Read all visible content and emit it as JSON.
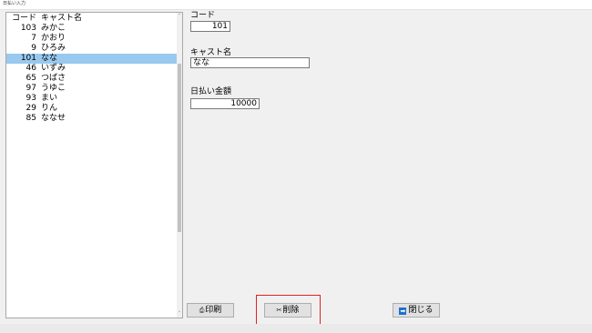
{
  "window": {
    "title": "日払い入力"
  },
  "list": {
    "headers": {
      "code": "コード",
      "name": "キャスト名"
    },
    "rows": [
      {
        "code": "103",
        "name": "みかこ"
      },
      {
        "code": "7",
        "name": "かおり"
      },
      {
        "code": "9",
        "name": "ひろみ"
      },
      {
        "code": "101",
        "name": "なな"
      },
      {
        "code": "46",
        "name": "いずみ"
      },
      {
        "code": "65",
        "name": "つばさ"
      },
      {
        "code": "97",
        "name": "うゆこ"
      },
      {
        "code": "93",
        "name": "まい"
      },
      {
        "code": "29",
        "name": "りん"
      },
      {
        "code": "85",
        "name": "ななせ"
      }
    ],
    "selected_index": 3,
    "scroll_up_glyph": "˄",
    "scroll_down_glyph": "˅"
  },
  "form": {
    "code": {
      "label": "コード",
      "value": "101"
    },
    "name": {
      "label": "キャスト名",
      "value": "なな"
    },
    "amount": {
      "label": "日払い金額",
      "value": "10000"
    }
  },
  "buttons": {
    "print": {
      "label": "印刷",
      "icon": "printer-icon",
      "glyph": "⎙"
    },
    "delete": {
      "label": "削除",
      "icon": "delete-icon",
      "glyph": "✂"
    },
    "close": {
      "label": "閉じる",
      "icon": "exit-icon",
      "glyph": "➡"
    }
  },
  "colors": {
    "selection": "#99c9ef",
    "focus_highlight": "#e02020",
    "exit_icon": "#1e6fd0"
  }
}
